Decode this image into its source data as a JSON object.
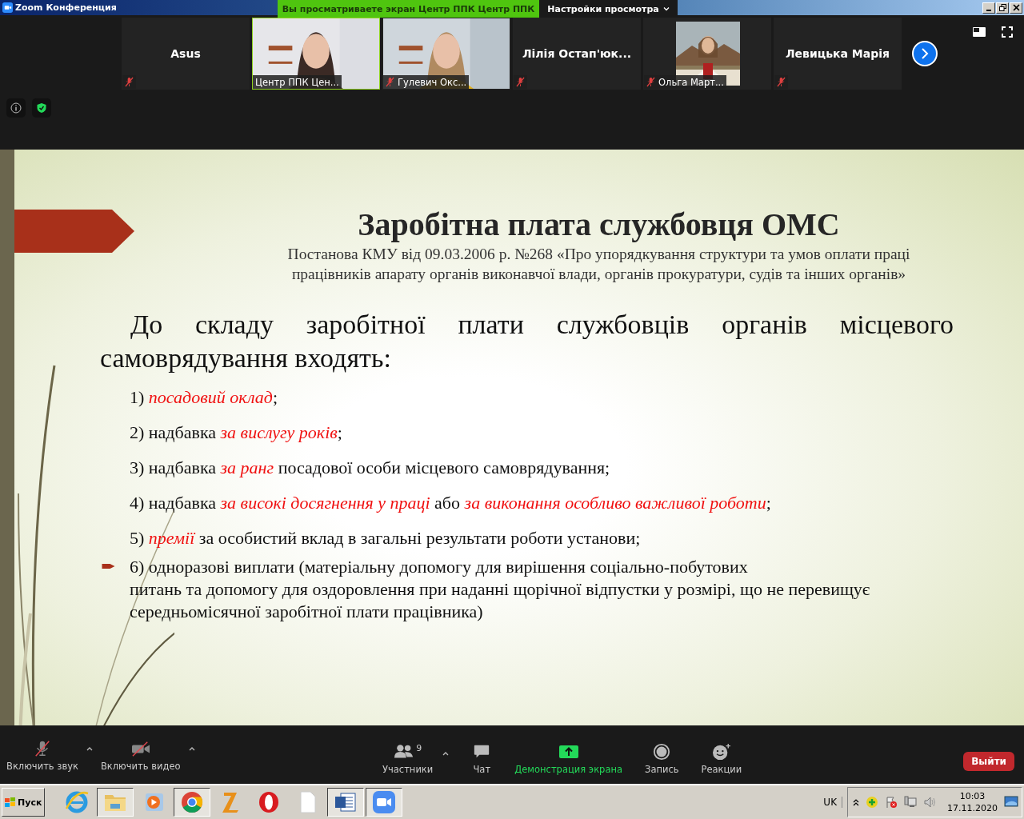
{
  "window": {
    "title": "Zoom Конференция"
  },
  "share_banner": {
    "text": "Вы просматриваете экран Центр ППК Центр ППК"
  },
  "view_options": {
    "label": "Настройки просмотра"
  },
  "participants": [
    {
      "kind": "name",
      "name": "Asus",
      "muted": true,
      "speaking": false
    },
    {
      "kind": "video",
      "name": "Центр ППК Цен...",
      "muted": false,
      "speaking": true
    },
    {
      "kind": "video",
      "name": "Гулевич Окс...",
      "muted": true,
      "speaking": false
    },
    {
      "kind": "name",
      "name": "Лілія  Остап'юк...",
      "muted": true,
      "speaking": false
    },
    {
      "name": "Ольга Март...",
      "muted": true,
      "speaking": false
    },
    {
      "kind": "name",
      "name": "Левицька Марія",
      "muted": true,
      "speaking": false
    }
  ],
  "slide": {
    "title": "Заробітна плата службовця ОМС",
    "subtitle": [
      "Постанова КМУ від 09.03.2006 р. №268 «Про упорядкування структури та умов оплати праці",
      "працівників апарату органів виконавчої влади, органів прокуратури, судів та інших органів»"
    ],
    "intro": "До складу заробітної плати службовців органів місцевого самоврядування входять:",
    "items": [
      {
        "bullet": false,
        "segments": [
          {
            "text": "1) ",
            "emphasis": false
          },
          {
            "text": "посадовий оклад",
            "emphasis": true
          },
          {
            "text": ";",
            "emphasis": false
          }
        ]
      },
      {
        "bullet": false,
        "segments": [
          {
            "text": "2) надбавка ",
            "emphasis": false
          },
          {
            "text": "за вислугу років",
            "emphasis": true
          },
          {
            "text": ";",
            "emphasis": false
          }
        ]
      },
      {
        "bullet": false,
        "segments": [
          {
            "text": "3) надбавка ",
            "emphasis": false
          },
          {
            "text": "за ранг",
            "emphasis": true
          },
          {
            "text": " посадової особи місцевого самоврядування;",
            "emphasis": false
          }
        ]
      },
      {
        "bullet": false,
        "segments": [
          {
            "text": "4) надбавка ",
            "emphasis": false
          },
          {
            "text": "за високі досягнення у праці",
            "emphasis": true
          },
          {
            "text": " або ",
            "emphasis": false
          },
          {
            "text": "за виконання особливо важливої роботи",
            "emphasis": true
          },
          {
            "text": ";",
            "emphasis": false
          }
        ]
      },
      {
        "bullet": false,
        "segments": [
          {
            "text": "5) ",
            "emphasis": false
          },
          {
            "text": "премії",
            "emphasis": true
          },
          {
            "text": " за особистий вклад в загальні результати роботи установи;",
            "emphasis": false
          }
        ]
      },
      {
        "bullet": true,
        "segments": [
          {
            "text": "6) одноразові виплати (матеріальну допомогу для вирішення соціально-побутових\nпитань та допомогу для оздоровлення при наданні щорічної відпустки у розмірі, що не перевищує середньомісячної заробітної плати працівника)",
            "emphasis": false
          }
        ]
      }
    ]
  },
  "toolbar": [
    {
      "kind": "mic",
      "label": "Включить звук",
      "active": false
    },
    {
      "kind": "video",
      "label": "Включить видео",
      "active": false
    },
    {
      "kind": "participants",
      "label": "Участники",
      "count": "9",
      "active": false
    },
    {
      "kind": "chat",
      "label": "Чат",
      "active": false
    },
    {
      "kind": "share",
      "label": "Демонстрация экрана",
      "active": true
    },
    {
      "kind": "record",
      "label": "Запись",
      "active": false
    },
    {
      "kind": "reactions",
      "label": "Реакции",
      "active": false
    }
  ],
  "leave_button": "Выйти",
  "taskbar": {
    "start": "Пуск",
    "apps": [
      {
        "kind": "ie",
        "pressed": false
      },
      {
        "kind": "folder",
        "pressed": true
      },
      {
        "kind": "player",
        "pressed": false
      },
      {
        "kind": "chrome",
        "pressed": true
      },
      {
        "kind": "archive",
        "pressed": false
      },
      {
        "kind": "opera",
        "pressed": false
      },
      {
        "kind": "file",
        "pressed": false
      },
      {
        "kind": "word",
        "pressed": true
      },
      {
        "kind": "zoom",
        "pressed": true
      }
    ],
    "language": "UK",
    "time": "10:03",
    "date": "17.11.2020"
  }
}
